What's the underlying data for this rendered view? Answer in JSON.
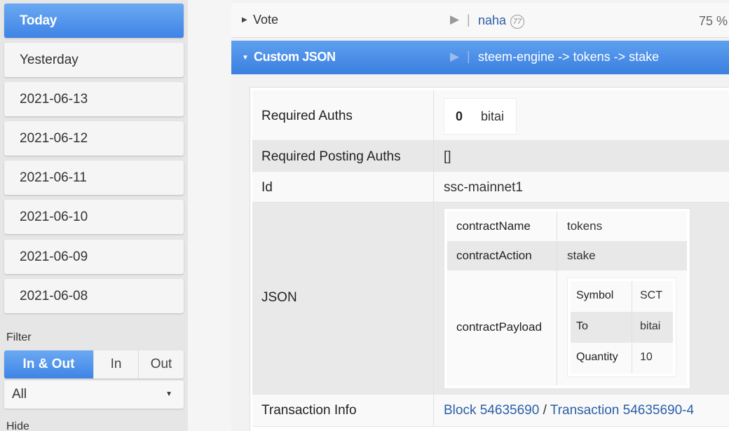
{
  "sidebar": {
    "days": [
      "Today",
      "Yesterday",
      "2021-06-13",
      "2021-06-12",
      "2021-06-11",
      "2021-06-10",
      "2021-06-09",
      "2021-06-08"
    ],
    "filter_label": "Filter",
    "filter_options": [
      "In & Out",
      "In",
      "Out"
    ],
    "select_value": "All",
    "hide_label": "Hide"
  },
  "vote": {
    "title": "Vote",
    "voter": "naha",
    "reputation": "77",
    "percent": "75 %"
  },
  "custom_json": {
    "title": "Custom JSON",
    "path": "steem-engine -> tokens -> stake"
  },
  "details": {
    "required_auths_label": "Required Auths",
    "required_auths_index": "0",
    "required_auths_name": "bitai",
    "required_posting_label": "Required Posting Auths",
    "required_posting_value": "[]",
    "id_label": "Id",
    "id_value": "ssc-mainnet1",
    "json_label": "JSON",
    "json": {
      "contract_name_key": "contractName",
      "contract_name_value": "tokens",
      "contract_action_key": "contractAction",
      "contract_action_value": "stake",
      "contract_payload_key": "contractPayload",
      "payload": {
        "symbol_key": "Symbol",
        "symbol_value": "SCT",
        "to_key": "To",
        "to_value": "bitai",
        "quantity_key": "Quantity",
        "quantity_value": "10"
      }
    },
    "tx_label": "Transaction Info",
    "block_link": "Block 54635690",
    "separator": "/",
    "tx_link": "Transaction 54635690-4"
  },
  "colors": {
    "accent": "#3f84e6",
    "link": "#2a5fa8"
  }
}
